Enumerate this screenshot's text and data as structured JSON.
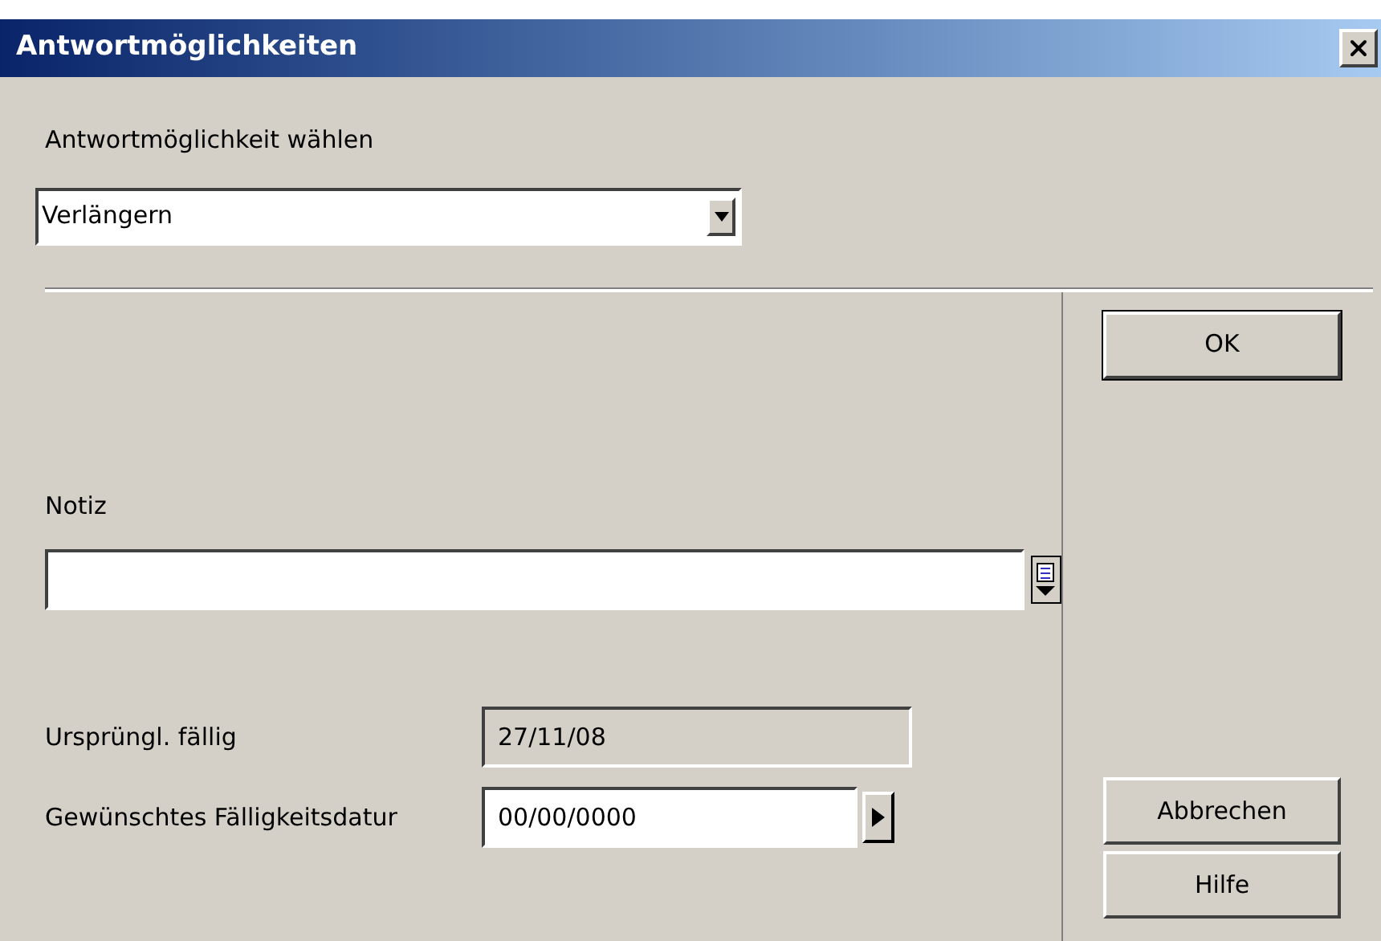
{
  "window": {
    "title": "Antwortmöglichkeiten"
  },
  "choice": {
    "label": "Antwortmöglichkeit wählen",
    "value": "Verlängern"
  },
  "note": {
    "label": "Notiz"
  },
  "dates": [
    {
      "label": "Ursprüngl. fällig",
      "value": "27/11/08",
      "readonly": true
    },
    {
      "label": "Gewünschtes Fälligkeitsdatur",
      "value": "00/00/0000",
      "readonly": false
    }
  ],
  "buttons": {
    "ok": "OK",
    "cancel": "Abbrechen",
    "help": "Hilfe"
  }
}
